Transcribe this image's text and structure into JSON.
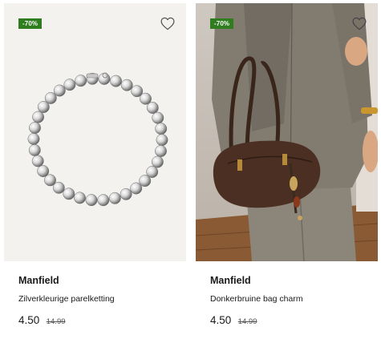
{
  "products": [
    {
      "discount_badge": "-70%",
      "brand": "Manfield",
      "name": "Zilverkleurige parelketting",
      "price": "4.50",
      "original_price": "14.99",
      "image": "silver-pearl-necklace",
      "favorite_icon": "heart-outline-icon"
    },
    {
      "discount_badge": "-70%",
      "brand": "Manfield",
      "name": "Donkerbruine bag charm",
      "price": "4.50",
      "original_price": "14.99",
      "image": "model-with-brown-bag-and-charm",
      "favorite_icon": "heart-outline-icon"
    }
  ],
  "colors": {
    "badge_bg": "#2f7d1f",
    "badge_text": "#ffffff",
    "text": "#1a1a1a"
  }
}
